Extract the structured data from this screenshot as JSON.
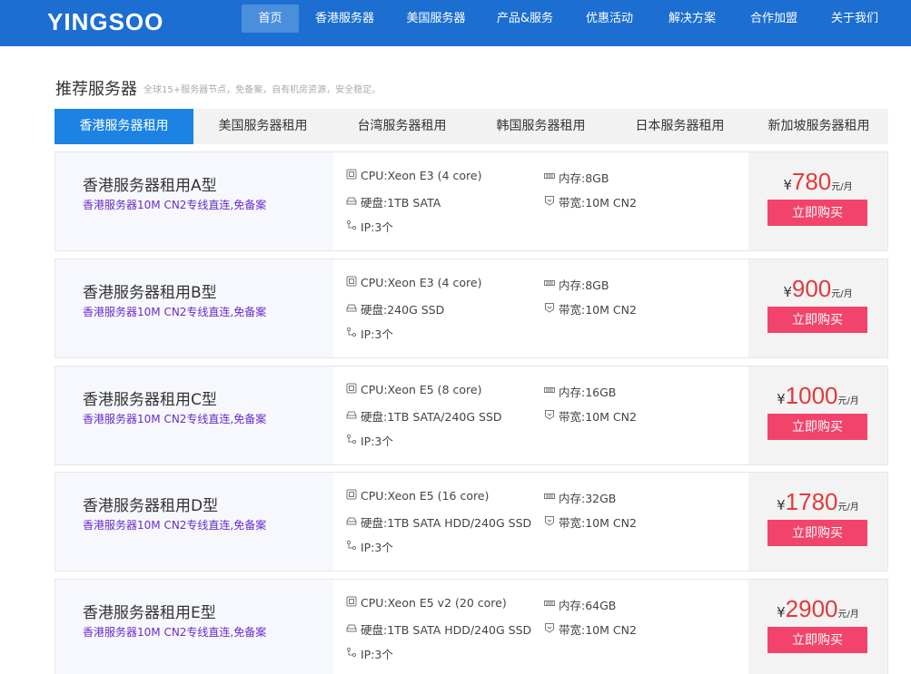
{
  "header": {
    "logo": "YINGSOO",
    "nav": [
      {
        "label": "首页",
        "active": true
      },
      {
        "label": "香港服务器",
        "active": false
      },
      {
        "label": "美国服务器",
        "active": false
      },
      {
        "label": "产品&服务",
        "active": false
      },
      {
        "label": "优惠活动",
        "active": false
      },
      {
        "label": "解决方案",
        "active": false
      },
      {
        "label": "合作加盟",
        "active": false
      },
      {
        "label": "关于我们",
        "active": false
      }
    ]
  },
  "section": {
    "title": "推荐服务器",
    "subtitle": "全球15+服务器节点，免备案，自有机房资源，安全稳定。"
  },
  "tabs": [
    {
      "label": "香港服务器租用",
      "active": true
    },
    {
      "label": "美国服务器租用",
      "active": false
    },
    {
      "label": "台湾服务器租用",
      "active": false
    },
    {
      "label": "韩国服务器租用",
      "active": false
    },
    {
      "label": "日本服务器租用",
      "active": false
    },
    {
      "label": "新加坡服务器租用",
      "active": false
    }
  ],
  "products": [
    {
      "name": "香港服务器租用A型",
      "desc": "香港服务器10M CN2专线直连,免备案",
      "cpu": "CPU:Xeon E3 (4 core)",
      "disk": "硬盘:1TB SATA",
      "ip": "IP:3个",
      "ram": "内存:8GB",
      "bw": "带宽:10M CN2",
      "currency": "¥",
      "price": "780",
      "unit": "元/月",
      "buy": "立即购买"
    },
    {
      "name": "香港服务器租用B型",
      "desc": "香港服务器10M CN2专线直连,免备案",
      "cpu": "CPU:Xeon E3 (4 core)",
      "disk": "硬盘:240G SSD",
      "ip": "IP:3个",
      "ram": "内存:8GB",
      "bw": "带宽:10M CN2",
      "currency": "¥",
      "price": "900",
      "unit": "元/月",
      "buy": "立即购买"
    },
    {
      "name": "香港服务器租用C型",
      "desc": "香港服务器10M CN2专线直连,免备案",
      "cpu": "CPU:Xeon E5 (8 core)",
      "disk": "硬盘:1TB SATA/240G SSD",
      "ip": "IP:3个",
      "ram": "内存:16GB",
      "bw": "带宽:10M CN2",
      "currency": "¥",
      "price": "1000",
      "unit": "元/月",
      "buy": "立即购买"
    },
    {
      "name": "香港服务器租用D型",
      "desc": "香港服务器10M CN2专线直连,免备案",
      "cpu": "CPU:Xeon E5 (16 core)",
      "disk": "硬盘:1TB SATA HDD/240G SSD",
      "ip": "IP:3个",
      "ram": "内存:32GB",
      "bw": "带宽:10M CN2",
      "currency": "¥",
      "price": "1780",
      "unit": "元/月",
      "buy": "立即购买"
    },
    {
      "name": "香港服务器租用E型",
      "desc": "香港服务器10M CN2专线直连,免备案",
      "cpu": "CPU:Xeon E5 v2 (20 core)",
      "disk": "硬盘:1TB SATA HDD/240G SSD",
      "ip": "IP:3个",
      "ram": "内存:64GB",
      "bw": "带宽:10M CN2",
      "currency": "¥",
      "price": "2900",
      "unit": "元/月",
      "buy": "立即购买"
    }
  ],
  "icons": {
    "cpu": "cpu-icon",
    "disk": "disk-icon",
    "ip": "network-icon",
    "ram": "memory-icon",
    "bandwidth": "bandwidth-icon"
  },
  "colors": {
    "header": "#1c6fd1",
    "tab_active": "#1c83e3",
    "price": "#e23a3a",
    "buy": "#f2436a",
    "desc": "#6a2cc9"
  }
}
